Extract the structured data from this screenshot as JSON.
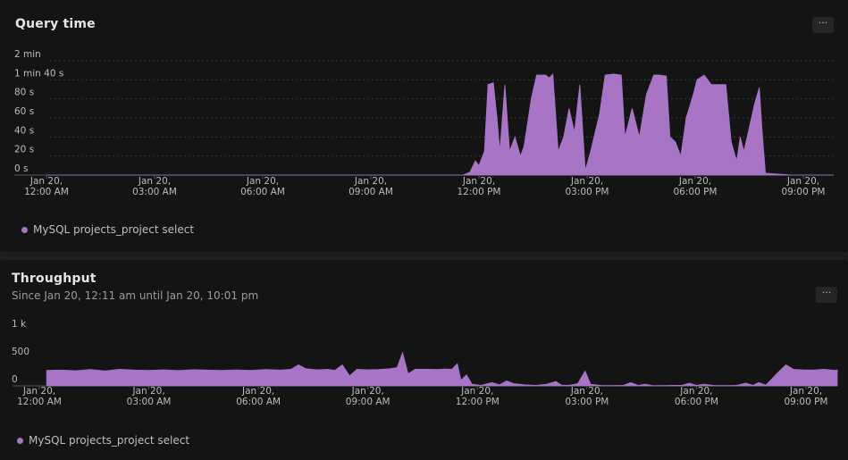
{
  "panels": {
    "query_time": {
      "title": "Query time",
      "menu_label": "···",
      "legend": "MySQL projects_project select"
    },
    "throughput": {
      "title": "Throughput",
      "subtitle": "Since Jan 20, 12:11 am until Jan 20, 10:01 pm",
      "menu_label": "···",
      "legend": "MySQL projects_project select"
    }
  },
  "colors": {
    "series": "#a875c6",
    "grid": "#3a3a3a",
    "axis": "#555555"
  },
  "chart_data": [
    {
      "type": "area",
      "title": "Query time",
      "x_unit": "hours since Jan 20, 12:00 AM",
      "xlim": [
        0,
        22.2
      ],
      "x_ticks": [
        {
          "x": 0,
          "label": [
            "Jan 20,",
            "12:00 AM"
          ]
        },
        {
          "x": 3,
          "label": [
            "Jan 20,",
            "03:00 AM"
          ]
        },
        {
          "x": 6,
          "label": [
            "Jan 20,",
            "06:00 AM"
          ]
        },
        {
          "x": 9,
          "label": [
            "Jan 20,",
            "09:00 AM"
          ]
        },
        {
          "x": 12,
          "label": [
            "Jan 20,",
            "12:00 PM"
          ]
        },
        {
          "x": 15,
          "label": [
            "Jan 20,",
            "03:00 PM"
          ]
        },
        {
          "x": 18,
          "label": [
            "Jan 20,",
            "06:00 PM"
          ]
        },
        {
          "x": 21,
          "label": [
            "Jan 20,",
            "09:00 PM"
          ]
        }
      ],
      "y_unit": "seconds",
      "ylim": [
        0,
        120
      ],
      "y_ticks": [
        {
          "v": 0,
          "label": "0 s"
        },
        {
          "v": 20,
          "label": "20 s"
        },
        {
          "v": 40,
          "label": "40 s"
        },
        {
          "v": 60,
          "label": "60 s"
        },
        {
          "v": 80,
          "label": "80 s"
        },
        {
          "v": 100,
          "label": "1 min 40 s"
        },
        {
          "v": 120,
          "label": "2 min"
        }
      ],
      "grid": true,
      "legend_position": "bottom-left",
      "series": [
        {
          "name": "MySQL projects_project select",
          "points": [
            [
              0.0,
              0
            ],
            [
              11.55,
              0
            ],
            [
              11.75,
              3
            ],
            [
              11.9,
              15
            ],
            [
              12.0,
              10
            ],
            [
              12.15,
              25
            ],
            [
              12.25,
              95
            ],
            [
              12.4,
              97
            ],
            [
              12.5,
              60
            ],
            [
              12.58,
              25
            ],
            [
              12.72,
              95
            ],
            [
              12.85,
              25
            ],
            [
              13.0,
              40
            ],
            [
              13.15,
              20
            ],
            [
              13.25,
              30
            ],
            [
              13.45,
              80
            ],
            [
              13.6,
              105
            ],
            [
              13.85,
              105
            ],
            [
              13.95,
              102
            ],
            [
              14.05,
              106
            ],
            [
              14.2,
              25
            ],
            [
              14.35,
              40
            ],
            [
              14.5,
              70
            ],
            [
              14.65,
              45
            ],
            [
              14.8,
              95
            ],
            [
              14.95,
              5
            ],
            [
              15.1,
              25
            ],
            [
              15.35,
              65
            ],
            [
              15.5,
              105
            ],
            [
              15.75,
              106
            ],
            [
              15.95,
              105
            ],
            [
              16.05,
              40
            ],
            [
              16.25,
              70
            ],
            [
              16.35,
              55
            ],
            [
              16.45,
              40
            ],
            [
              16.65,
              85
            ],
            [
              16.85,
              105
            ],
            [
              17.0,
              105
            ],
            [
              17.2,
              104
            ],
            [
              17.3,
              40
            ],
            [
              17.45,
              35
            ],
            [
              17.6,
              20
            ],
            [
              17.75,
              60
            ],
            [
              17.95,
              85
            ],
            [
              18.05,
              100
            ],
            [
              18.25,
              105
            ],
            [
              18.45,
              95
            ],
            [
              18.7,
              95
            ],
            [
              18.85,
              95
            ],
            [
              19.0,
              35
            ],
            [
              19.15,
              15
            ],
            [
              19.25,
              40
            ],
            [
              19.35,
              25
            ],
            [
              19.5,
              50
            ],
            [
              19.65,
              75
            ],
            [
              19.78,
              92
            ],
            [
              19.85,
              50
            ],
            [
              19.95,
              2
            ],
            [
              20.3,
              1
            ],
            [
              20.7,
              0
            ],
            [
              22.2,
              0
            ]
          ]
        }
      ]
    },
    {
      "type": "area",
      "title": "Throughput",
      "x_unit": "hours since Jan 20, 12:00 AM",
      "xlim": [
        0,
        22.2
      ],
      "x_ticks": [
        {
          "x": 0,
          "label": [
            "Jan 20,",
            "12:00 AM"
          ]
        },
        {
          "x": 3,
          "label": [
            "Jan 20,",
            "03:00 AM"
          ]
        },
        {
          "x": 6,
          "label": [
            "Jan 20,",
            "06:00 AM"
          ]
        },
        {
          "x": 9,
          "label": [
            "Jan 20,",
            "09:00 AM"
          ]
        },
        {
          "x": 12,
          "label": [
            "Jan 20,",
            "12:00 PM"
          ]
        },
        {
          "x": 15,
          "label": [
            "Jan 20,",
            "03:00 PM"
          ]
        },
        {
          "x": 18,
          "label": [
            "Jan 20,",
            "06:00 PM"
          ]
        },
        {
          "x": 21,
          "label": [
            "Jan 20,",
            "09:00 PM"
          ]
        }
      ],
      "ylim": [
        0,
        1000
      ],
      "y_ticks": [
        {
          "v": 0,
          "label": "0"
        },
        {
          "v": 500,
          "label": "500"
        },
        {
          "v": 1000,
          "label": "1 k"
        }
      ],
      "grid": false,
      "legend_position": "bottom-left",
      "series": [
        {
          "name": "MySQL projects_project select",
          "points": [
            [
              0.2,
              280
            ],
            [
              0.6,
              285
            ],
            [
              1.0,
              275
            ],
            [
              1.4,
              295
            ],
            [
              1.8,
              270
            ],
            [
              2.2,
              300
            ],
            [
              2.6,
              285
            ],
            [
              3.0,
              280
            ],
            [
              3.4,
              290
            ],
            [
              3.8,
              278
            ],
            [
              4.2,
              292
            ],
            [
              4.6,
              285
            ],
            [
              5.0,
              280
            ],
            [
              5.4,
              288
            ],
            [
              5.8,
              280
            ],
            [
              6.2,
              295
            ],
            [
              6.6,
              285
            ],
            [
              6.9,
              300
            ],
            [
              7.1,
              380
            ],
            [
              7.3,
              310
            ],
            [
              7.6,
              290
            ],
            [
              7.9,
              300
            ],
            [
              8.1,
              280
            ],
            [
              8.3,
              380
            ],
            [
              8.5,
              180
            ],
            [
              8.7,
              300
            ],
            [
              9.0,
              290
            ],
            [
              9.3,
              295
            ],
            [
              9.6,
              310
            ],
            [
              9.8,
              330
            ],
            [
              9.95,
              600
            ],
            [
              10.1,
              220
            ],
            [
              10.3,
              300
            ],
            [
              10.6,
              300
            ],
            [
              10.9,
              295
            ],
            [
              11.1,
              305
            ],
            [
              11.3,
              300
            ],
            [
              11.45,
              400
            ],
            [
              11.55,
              100
            ],
            [
              11.7,
              200
            ],
            [
              11.85,
              30
            ],
            [
              12.1,
              10
            ],
            [
              12.4,
              60
            ],
            [
              12.6,
              20
            ],
            [
              12.8,
              90
            ],
            [
              13.0,
              40
            ],
            [
              13.3,
              20
            ],
            [
              13.6,
              10
            ],
            [
              13.9,
              30
            ],
            [
              14.15,
              80
            ],
            [
              14.3,
              15
            ],
            [
              14.5,
              10
            ],
            [
              14.75,
              40
            ],
            [
              14.95,
              270
            ],
            [
              15.1,
              30
            ],
            [
              15.4,
              5
            ],
            [
              15.7,
              5
            ],
            [
              16.0,
              10
            ],
            [
              16.2,
              60
            ],
            [
              16.4,
              10
            ],
            [
              16.6,
              30
            ],
            [
              16.8,
              5
            ],
            [
              17.1,
              5
            ],
            [
              17.4,
              10
            ],
            [
              17.6,
              10
            ],
            [
              17.8,
              50
            ],
            [
              18.0,
              10
            ],
            [
              18.2,
              30
            ],
            [
              18.5,
              5
            ],
            [
              18.9,
              5
            ],
            [
              19.1,
              10
            ],
            [
              19.35,
              50
            ],
            [
              19.55,
              10
            ],
            [
              19.7,
              60
            ],
            [
              19.9,
              15
            ],
            [
              20.2,
              220
            ],
            [
              20.45,
              380
            ],
            [
              20.65,
              300
            ],
            [
              20.9,
              290
            ],
            [
              21.2,
              285
            ],
            [
              21.5,
              300
            ],
            [
              21.8,
              280
            ],
            [
              22.2,
              290
            ]
          ]
        }
      ]
    }
  ]
}
